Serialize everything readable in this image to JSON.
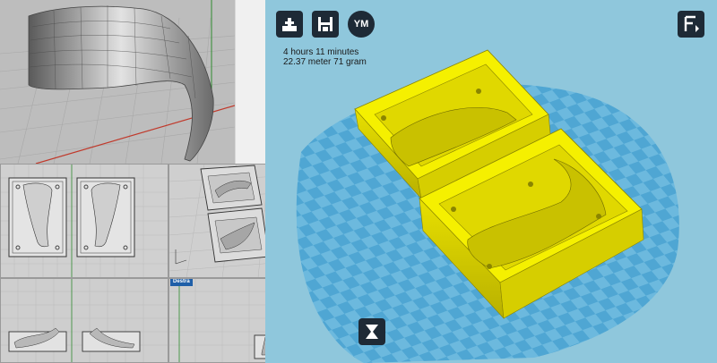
{
  "cura": {
    "print_time": "4 hours 11 minutes",
    "material": "22.37 meter 71 gram",
    "buttons": {
      "load": "load-model",
      "save": "save-gcode",
      "view_mode_label": "YM",
      "layers": "view-layers",
      "rotate": "rotate-tool"
    },
    "colors": {
      "background": "#8fc7dc",
      "plate": "#4fa6d3",
      "model": "#f5f000",
      "button": "#1e2a36"
    }
  },
  "rhino": {
    "viewport_labels": {
      "right": "Destra"
    },
    "colors": {
      "grid_axis_x": "#c0392b",
      "grid_axis_y": "#2e8b2e",
      "label_bg": "#1f5fa8"
    }
  }
}
